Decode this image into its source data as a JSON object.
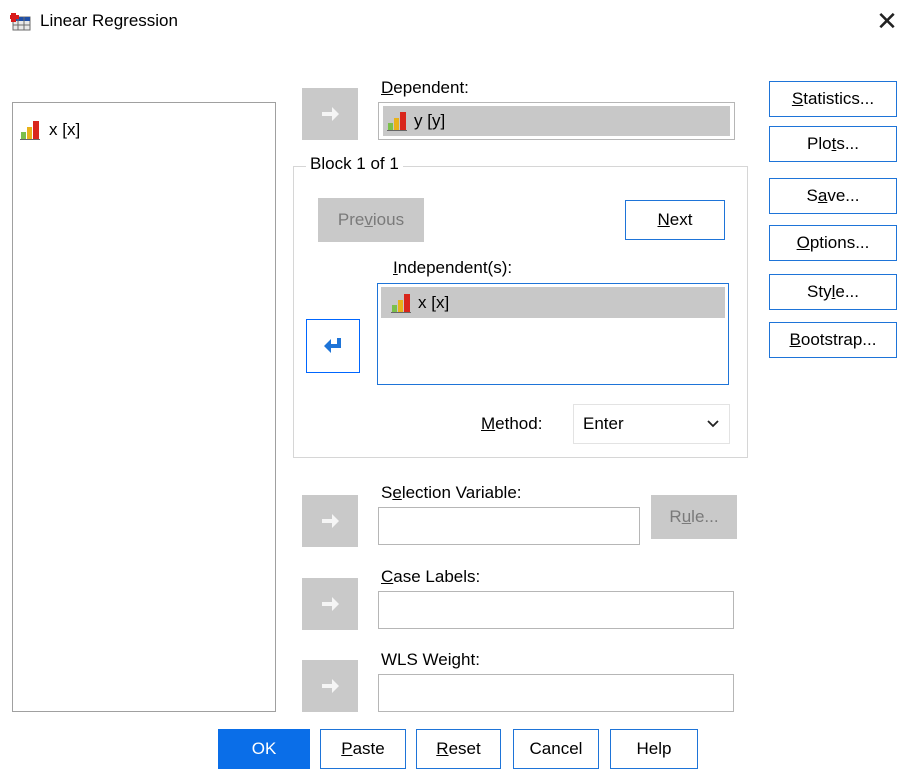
{
  "window": {
    "title": "Linear Regression",
    "app_icon": "spss-dialog-icon",
    "close_icon": "close-icon"
  },
  "source_list": {
    "items": [
      {
        "label": "x [x]",
        "icon": "scale-variable-icon"
      }
    ]
  },
  "dependent": {
    "label_pre": "",
    "label_mnemonic": "D",
    "label_post": "ependent:",
    "value": "y [y]",
    "icon": "scale-variable-icon"
  },
  "block": {
    "title": "Block 1 of 1",
    "previous": {
      "pre": "Pre",
      "mnemonic": "v",
      "post": "ious"
    },
    "next": {
      "pre": "",
      "mnemonic": "N",
      "post": "ext"
    },
    "independent": {
      "label_pre": "",
      "label_mnemonic": "I",
      "label_post": "ndependent(s):",
      "items": [
        {
          "label": "x [x]",
          "icon": "scale-variable-icon"
        }
      ]
    },
    "method": {
      "label_pre": "",
      "label_mnemonic": "M",
      "label_post": "ethod:",
      "value": "Enter",
      "icon": "chevron-down-icon"
    }
  },
  "selection_variable": {
    "label_pre": "S",
    "label_mnemonic": "e",
    "label_post": "lection Variable:",
    "value": "",
    "rule": {
      "pre": "R",
      "mnemonic": "u",
      "post": "le..."
    }
  },
  "case_labels": {
    "label_pre": "",
    "label_mnemonic": "C",
    "label_post": "ase Labels:",
    "value": ""
  },
  "wls_weight": {
    "label_pre": "WLS Wei",
    "label_mnemonic": "g",
    "label_post": "ht:",
    "value": ""
  },
  "side_buttons": [
    {
      "pre": "",
      "mnemonic": "S",
      "post": "tatistics..."
    },
    {
      "pre": "Plo",
      "mnemonic": "t",
      "post": "s..."
    },
    {
      "pre": "S",
      "mnemonic": "a",
      "post": "ve..."
    },
    {
      "pre": "",
      "mnemonic": "O",
      "post": "ptions..."
    },
    {
      "pre": "Sty",
      "mnemonic": "l",
      "post": "e..."
    },
    {
      "pre": "",
      "mnemonic": "B",
      "post": "ootstrap..."
    }
  ],
  "bottom_buttons": {
    "ok": "OK",
    "paste": {
      "pre": "",
      "mnemonic": "P",
      "post": "aste"
    },
    "reset": {
      "pre": "",
      "mnemonic": "R",
      "post": "eset"
    },
    "cancel": "Cancel",
    "help": "Help"
  },
  "colors": {
    "accent": "#1e74d8",
    "ok_button": "#0a6ee8",
    "disabled": "#c9c9c9",
    "selected_row": "#c8c8c8"
  }
}
